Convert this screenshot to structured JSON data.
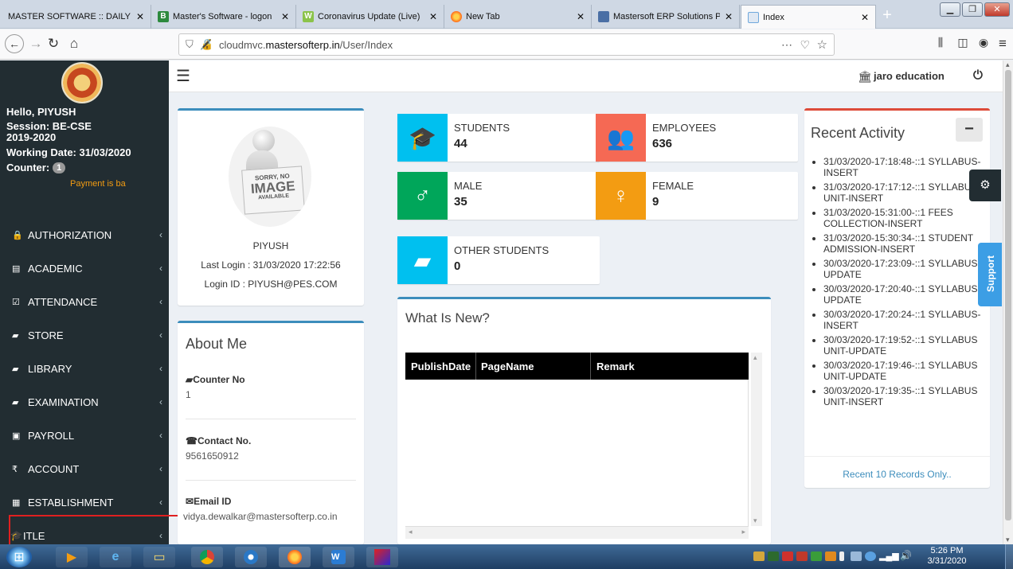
{
  "browser": {
    "tabs": [
      {
        "title": "MASTER SOFTWARE :: DAILY F",
        "fav_color": "#cfd8e4"
      },
      {
        "title": "Master's Software - logon",
        "fav_color": "#2d8a3e",
        "fav_glyph": "B"
      },
      {
        "title": "Coronavirus Update (Live)",
        "fav_color": "#8bc34a",
        "fav_glyph": "W"
      },
      {
        "title": "New Tab",
        "fav_color": "#ff7a1a"
      },
      {
        "title": "Mastersoft ERP Solutions P",
        "fav_color": "#4a6fa5"
      },
      {
        "title": "Index",
        "fav_color": "#6fa8dc"
      }
    ],
    "url_prefix": "cloudmvc.",
    "url_domain": "mastersofterp.in",
    "url_path": "/User/Index",
    "new_tab": "+"
  },
  "sidebar": {
    "greeting": "Hello, PIYUSH",
    "session": "Session: BE-CSE 2019-2020",
    "working_date": "Working Date: 31/03/2020",
    "counter_label": "Counter:",
    "counter_value": "1",
    "payment_notice": "Payment is ba",
    "items": [
      {
        "label": "AUTHORIZATION",
        "icon": "lock-icon",
        "glyph": "🔒"
      },
      {
        "label": "ACADEMIC",
        "icon": "file-icon",
        "glyph": "▤"
      },
      {
        "label": "ATTENDANCE",
        "icon": "checkbox-icon",
        "glyph": "☑"
      },
      {
        "label": "STORE",
        "icon": "book-icon",
        "glyph": "▰"
      },
      {
        "label": "LIBRARY",
        "icon": "book-icon",
        "glyph": "▰"
      },
      {
        "label": "EXAMINATION",
        "icon": "book-icon",
        "glyph": "▰"
      },
      {
        "label": "PAYROLL",
        "icon": "money-icon",
        "glyph": "▣"
      },
      {
        "label": "ACCOUNT",
        "icon": "rupee-icon",
        "glyph": "₹"
      },
      {
        "label": "ESTABLISHMENT",
        "icon": "calendar-icon",
        "glyph": "▦"
      },
      {
        "label": "ITLE",
        "icon": "graduation-cap-icon",
        "glyph": "🎓"
      }
    ]
  },
  "header": {
    "org_name": "jaro education"
  },
  "profile": {
    "placeholder_line1": "SORRY, NO",
    "placeholder_line2": "IMAGE",
    "placeholder_line3": "AVAILABLE",
    "name": "PIYUSH",
    "last_login": "Last Login : 31/03/2020 17:22:56",
    "login_id": "Login ID : PIYUSH@PES.COM"
  },
  "about": {
    "title": "About Me",
    "counter_label": "Counter No",
    "counter_value": "1",
    "contact_label": "Contact No.",
    "contact_value": "9561650912",
    "email_label": "Email ID",
    "email_value": "vidya.dewalkar@mastersofterp.co.in"
  },
  "stats": [
    {
      "label": "STUDENTS",
      "value": "44",
      "color": "#00c0ef",
      "icon": "graduation-cap-icon"
    },
    {
      "label": "EMPLOYEES",
      "value": "636",
      "color": "#f56954",
      "icon": "users-icon"
    },
    {
      "label": "MALE",
      "value": "35",
      "color": "#00a65a",
      "icon": "male-icon"
    },
    {
      "label": "FEMALE",
      "value": "9",
      "color": "#f39c12",
      "icon": "female-icon"
    },
    {
      "label": "OTHER STUDENTS",
      "value": "0",
      "color": "#00c0ef",
      "icon": "book-icon"
    }
  ],
  "whats_new": {
    "title": "What Is New?",
    "columns": [
      "PublishDate",
      "PageName",
      "Remark"
    ]
  },
  "activity": {
    "title": "Recent Activity",
    "collapse": "−",
    "items": [
      "31/03/2020-17:18:48-::1 SYLLABUS-INSERT",
      "31/03/2020-17:17:12-::1 SYLLABUS UNIT-INSERT",
      "31/03/2020-15:31:00-::1 FEES COLLECTION-INSERT",
      "31/03/2020-15:30:34-::1 STUDENT ADMISSION-INSERT",
      "30/03/2020-17:23:09-::1 SYLLABUS-UPDATE",
      "30/03/2020-17:20:40-::1 SYLLABUS-UPDATE",
      "30/03/2020-17:20:24-::1 SYLLABUS-INSERT",
      "30/03/2020-17:19:52-::1 SYLLABUS UNIT-UPDATE",
      "30/03/2020-17:19:46-::1 SYLLABUS UNIT-UPDATE",
      "30/03/2020-17:19:35-::1 SYLLABUS UNIT-INSERT"
    ],
    "footer": "Recent 10 Records Only.."
  },
  "support_label": "Support",
  "taskbar": {
    "time": "5:26 PM",
    "date": "3/31/2020"
  }
}
